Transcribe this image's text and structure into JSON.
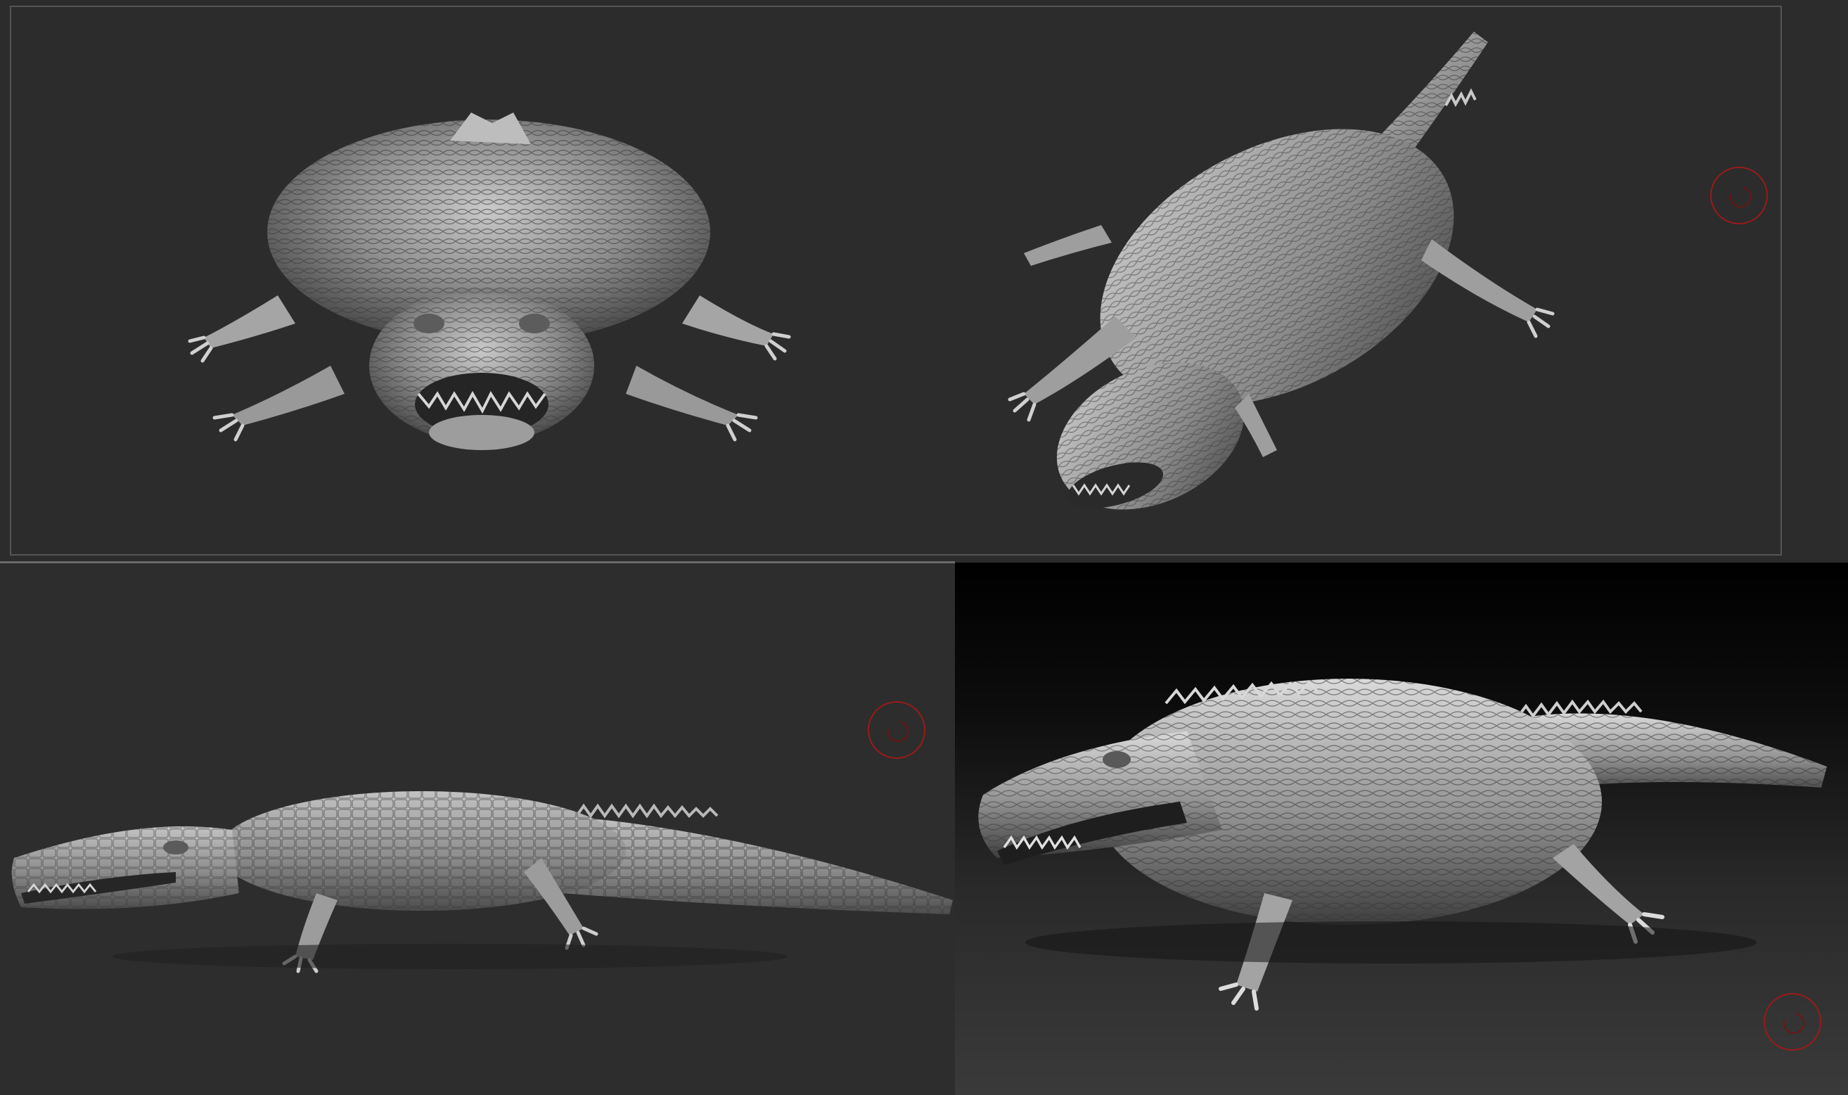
{
  "viewports": [
    {
      "id": "front",
      "view": "front"
    },
    {
      "id": "three-quarter-top",
      "view": "three-quarter-top"
    },
    {
      "id": "side",
      "view": "side"
    },
    {
      "id": "perspective-render",
      "view": "perspective"
    }
  ],
  "subject": "crocodile-sculpt",
  "colors": {
    "background": "#2c2c2c",
    "frame": "#555555",
    "gizmo": "#9a1a1a",
    "model": "#8f8f8f"
  },
  "icons": {
    "gizmo": "rotation-gizmo-icon"
  }
}
